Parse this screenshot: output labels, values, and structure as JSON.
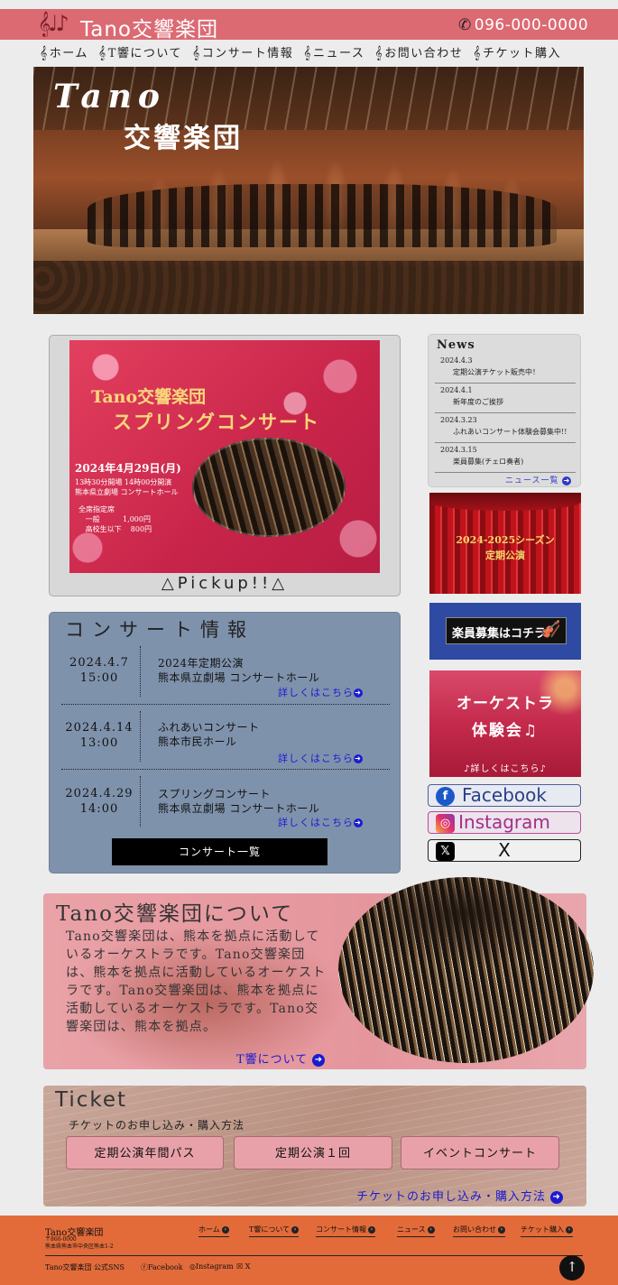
{
  "header": {
    "logo_notes": "𝄞♩♪",
    "logo_text": "Tano交響楽団",
    "phone_icon": "phone-icon",
    "phone": "096-000-0000"
  },
  "nav": {
    "clef": "𝄞",
    "items": [
      "ホーム",
      "T響について",
      "コンサート情報",
      "ニュース",
      "お問い合わせ",
      "チケット購入"
    ]
  },
  "hero": {
    "title_line1": "Tano",
    "title_line2": "交響楽団"
  },
  "pickup": {
    "poster_title1": "Tano交響楽団",
    "poster_title2": "スプリングコンサート",
    "poster_date": "2024年4月29日(月)",
    "poster_time": "13時30分開場 14時00分開演\n熊本県立劇場 コンサートホール",
    "poster_price": "全席指定席\n   一般          1,000円\n   高校生以下    800円",
    "label": "△Pickup!!△"
  },
  "news": {
    "title": "News",
    "items": [
      {
        "date": "2024.4.3",
        "text": "定期公演チケット販売中！"
      },
      {
        "date": "2024.4.1",
        "text": "新年度のご挨拶"
      },
      {
        "date": "2024.3.23",
        "text": "ふれあいコンサート体験会募集中!!"
      },
      {
        "date": "2024.3.15",
        "text": "楽員募集(チェロ奏者)"
      }
    ],
    "more": "ニュース一覧",
    "arrow": "➜"
  },
  "banners": {
    "season": "2024-2025シーズン\n定期公演",
    "recruit": "楽員募集はコチラ",
    "recruit_icon": "violin-icon",
    "exp_line1": "オーケストラ",
    "exp_line2": "体験会♫",
    "exp_link": "♪詳しくはこちら♪"
  },
  "sns": {
    "facebook": "Facebook",
    "instagram": "Instagram",
    "x": "X",
    "fb_icon": "f",
    "ig_icon": "◎",
    "x_icon": "𝕏"
  },
  "concert": {
    "title": "コンサート情報",
    "rows": [
      {
        "date": "2024.4.7\n15:00",
        "name": "2024年定期公演",
        "venue": "熊本県立劇場 コンサートホール",
        "link": "詳しくはこちら"
      },
      {
        "date": "2024.4.14\n13:00",
        "name": "ふれあいコンサート",
        "venue": "熊本市民ホール",
        "link": "詳しくはこちら"
      },
      {
        "date": "2024.4.29\n14:00",
        "name": "スプリングコンサート",
        "venue": "熊本県立劇場 コンサートホール",
        "link": "詳しくはこちら"
      }
    ],
    "list_button": "コンサート一覧"
  },
  "about": {
    "title": "Tano交響楽団について",
    "body": "Tano交響楽団は、熊本を拠点に活動しているオーケストラです。Tano交響楽団は、熊本を拠点に活動しているオーケストラです。Tano交響楽団は、熊本を拠点に活動しているオーケストラです。Tano交響楽団は、熊本を拠点。",
    "link": "T響について"
  },
  "ticket": {
    "title": "Ticket",
    "subtitle": "チケットのお申し込み・購入方法",
    "buttons": [
      "定期公演年間パス",
      "定期公演１回",
      "イベントコンサート"
    ],
    "link": "チケットのお申し込み・購入方法"
  },
  "footer": {
    "name": "Tano交響楽団",
    "address": "〒860-0000\n熊本県熊本市中央区熊本1-2",
    "nav": [
      "ホーム",
      "T響について",
      "コンサート情報",
      "ニュース",
      "お問い合わせ",
      "チケット購入"
    ],
    "sns_label": "Tano交響楽団 公式SNS",
    "sns": [
      "Facebook",
      "Instagram",
      "X"
    ],
    "top_arrow": "↑"
  },
  "colors": {
    "header": "#dc6a73",
    "footer": "#e36b3a",
    "concert_bg": "#7f92ac",
    "link": "#1b1bd0"
  }
}
